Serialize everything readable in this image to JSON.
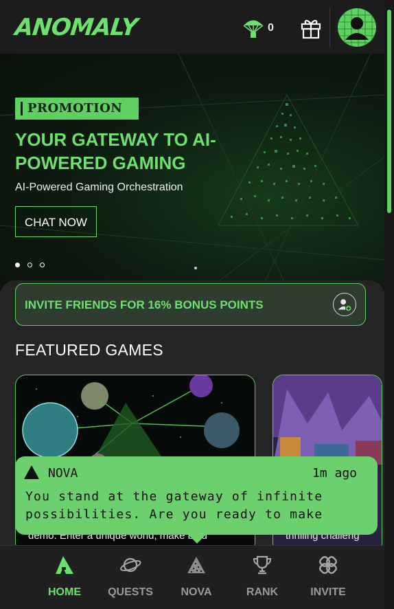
{
  "header": {
    "logo_text": "ANOMALY",
    "airdrop_icon": "parachute-icon",
    "airdrop_count": "0",
    "gift_icon": "gift-icon",
    "avatar_icon": "user-avatar-icon"
  },
  "hero": {
    "badge": "PROMOTION",
    "title": "YOUR GATEWAY TO AI-POWERED GAMING",
    "subtitle": "AI-Powered Gaming Orchestration",
    "cta": "CHAT NOW",
    "slides_total": 3,
    "active_slide": 0
  },
  "invite_banner": {
    "text": "INVITE FRIENDS FOR 16% BONUS POINTS",
    "icon": "add-user-icon"
  },
  "featured": {
    "title": "FEATURED GAMES",
    "cards": [
      {
        "desc": "demo. Enter a unique world, make bold"
      },
      {
        "desc": "thrilling challeng"
      }
    ]
  },
  "nova_popup": {
    "name": "NOVA",
    "time": "1m ago",
    "message": "You stand at the gateway of infinite possibilities. Are you ready to make"
  },
  "nav": {
    "items": [
      {
        "label": "HOME",
        "icon": "home-logo-icon",
        "active": true
      },
      {
        "label": "QUESTS",
        "icon": "planet-icon",
        "active": false
      },
      {
        "label": "NOVA",
        "icon": "pyramid-icon",
        "active": false
      },
      {
        "label": "RANK",
        "icon": "trophy-icon",
        "active": false
      },
      {
        "label": "INVITE",
        "icon": "link-icon",
        "active": false
      }
    ]
  },
  "colors": {
    "accent": "#6ee06f",
    "background": "#242424",
    "popup": "#6cd06e"
  }
}
